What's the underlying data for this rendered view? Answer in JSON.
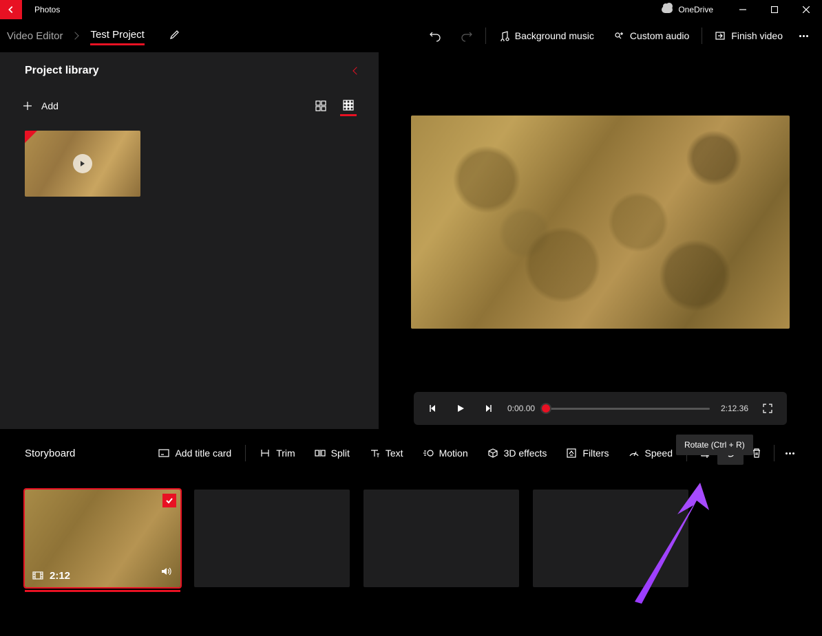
{
  "titlebar": {
    "app_name": "Photos",
    "onedrive": "OneDrive"
  },
  "topbar": {
    "breadcrumb_root": "Video Editor",
    "project_name": "Test Project",
    "bg_music": "Background music",
    "custom_audio": "Custom audio",
    "finish": "Finish video"
  },
  "library": {
    "title": "Project library",
    "add": "Add"
  },
  "player": {
    "current": "0:00.00",
    "total": "2:12.36"
  },
  "storyboard": {
    "title": "Storyboard",
    "add_title_card": "Add title card",
    "trim": "Trim",
    "split": "Split",
    "text": "Text",
    "motion": "Motion",
    "effects_3d": "3D effects",
    "filters": "Filters",
    "speed": "Speed",
    "clip_duration": "2:12"
  },
  "tooltip": {
    "rotate": "Rotate (Ctrl + R)"
  }
}
